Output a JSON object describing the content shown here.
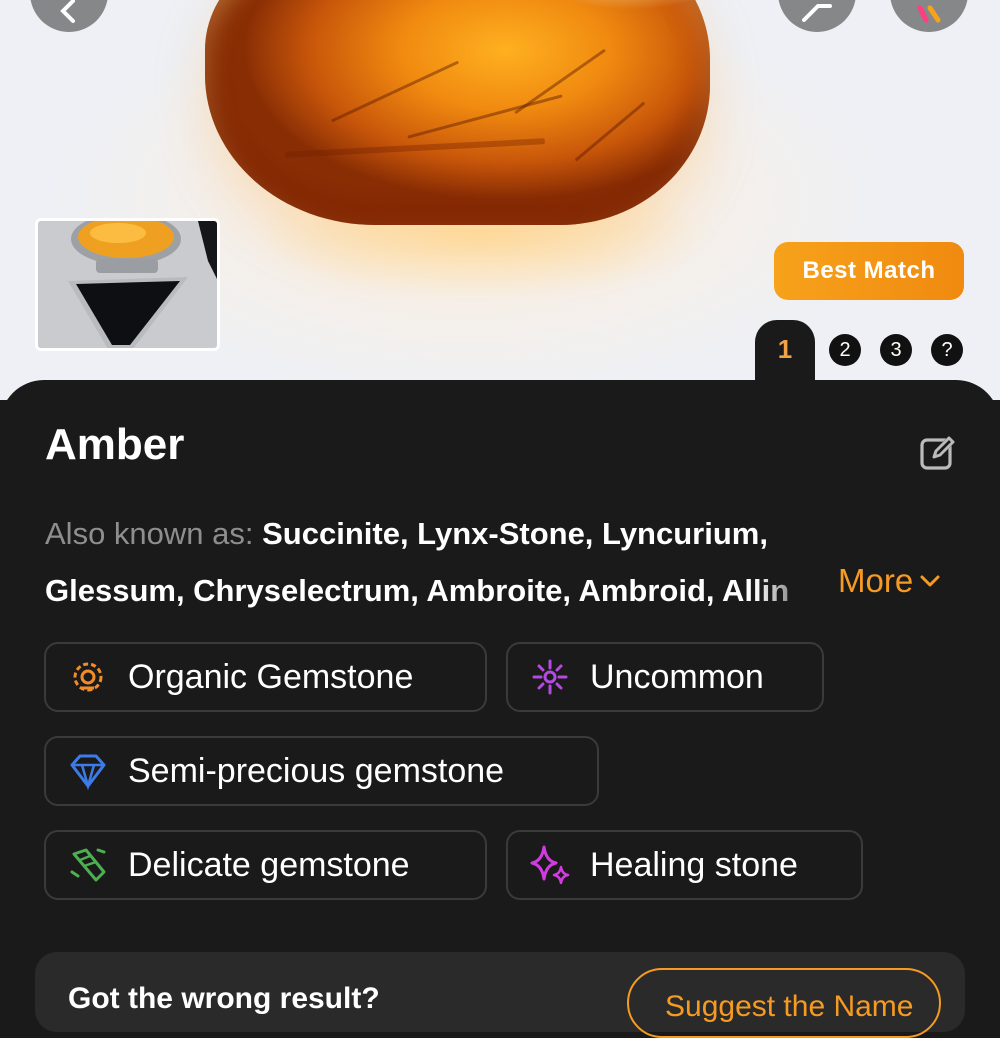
{
  "header": {
    "back_icon": "chevron-left-icon",
    "share_icon": "share-icon",
    "art_icon": "art-icon"
  },
  "thumbnail": {
    "alt": "uploaded photo"
  },
  "badge": {
    "label": "Best Match"
  },
  "pager": {
    "active": "1",
    "pages": [
      "2",
      "3",
      "?"
    ]
  },
  "result": {
    "title": "Amber",
    "aka_label": "Also known as:",
    "aka_line1": "Succinite, Lynx-Stone, Lyncurium,",
    "aka_line2": "Glessum, Chryselectrum, Ambroite, Ambroid, Allin",
    "more_label": "More"
  },
  "tags": [
    {
      "label": "Organic Gemstone",
      "icon": "organic-icon",
      "color": "#f28c28"
    },
    {
      "label": "Uncommon",
      "icon": "sparkle-icon",
      "color": "#b44be0"
    },
    {
      "label": "Semi-precious gemstone",
      "icon": "diamond-icon",
      "color": "#3d7be8"
    },
    {
      "label": "Delicate gemstone",
      "icon": "crystal-icon",
      "color": "#4cb050"
    },
    {
      "label": "Healing stone",
      "icon": "stars-icon",
      "color": "#d13be0"
    }
  ],
  "feedback": {
    "text": "Got the wrong result?",
    "button_label": "Suggest the Name"
  },
  "colors": {
    "accent": "#f59a23",
    "sheet": "#1a1a1a",
    "badge": "#f7a21b"
  }
}
